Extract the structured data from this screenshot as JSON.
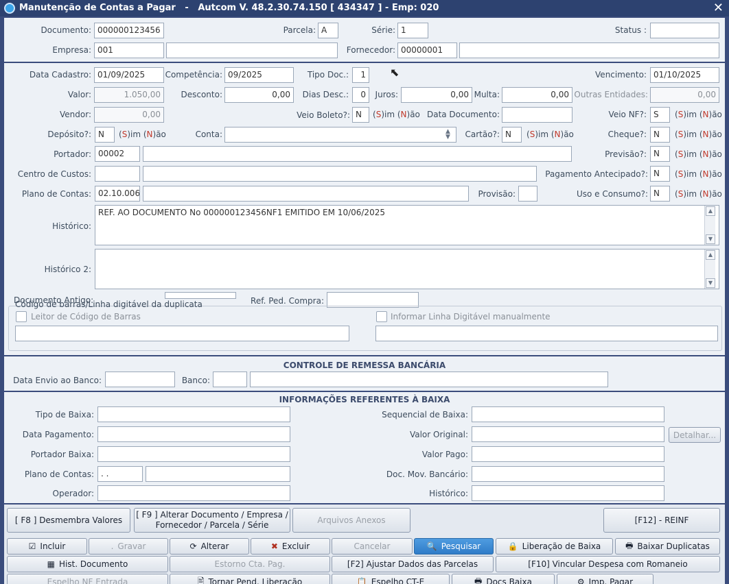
{
  "window": {
    "title": "Manutenção de Contas a Pagar   -   Autcom V. 48.2.30.74.150 [ 434347 ] - Emp: 020",
    "close": "✕"
  },
  "header": {
    "documento_label": "Documento:",
    "documento": "000000123456",
    "parcela_label": "Parcela:",
    "parcela": "A",
    "serie_label": "Série:",
    "serie": "1",
    "status_label": "Status :",
    "status": "",
    "empresa_label": "Empresa:",
    "empresa": "001",
    "empresa_nome": "",
    "fornecedor_label": "Fornecedor:",
    "fornecedor": "00000001",
    "fornecedor_nome": ""
  },
  "form": {
    "data_cadastro_label": "Data Cadastro:",
    "data_cadastro": "01/09/2025",
    "competencia_label": "Competência:",
    "competencia": "09/2025",
    "tipo_doc_label": "Tipo Doc.:",
    "tipo_doc": "1",
    "vencimento_label": "Vencimento:",
    "vencimento": "01/10/2025",
    "valor_label": "Valor:",
    "valor": "1.050,00",
    "desconto_label": "Desconto:",
    "desconto": "0,00",
    "dias_desc_label": "Dias Desc.:",
    "dias_desc": "0",
    "juros_label": "Juros:",
    "juros": "0,00",
    "multa_label": "Multa:",
    "multa": "0,00",
    "outras_label": "Outras Entidades:",
    "outras": "0,00",
    "vendor_label": "Vendor:",
    "vendor": "0,00",
    "veio_boleto_label": "Veio Boleto?:",
    "veio_boleto": "N",
    "data_documento_label": "Data Documento:",
    "data_documento": "",
    "veio_nf_label": "Veio NF?:",
    "veio_nf": "S",
    "deposito_label": "Depósito?:",
    "deposito": "N",
    "conta_label": "Conta:",
    "conta": "",
    "cartao_label": "Cartão?:",
    "cartao": "N",
    "cheque_label": "Cheque?:",
    "cheque": "N",
    "portador_label": "Portador:",
    "portador": "00002",
    "portador_nome": "",
    "previsao_label": "Previsão?:",
    "previsao": "N",
    "centro_label": "Centro de Custos:",
    "centro": "",
    "centro_nome": "",
    "pag_antecipado_label": "Pagamento Antecipado?:",
    "pag_antecipado": "N",
    "plano_label": "Plano de Contas:",
    "plano": "02.10.006",
    "plano_nome": "",
    "provisao_label": "Provisão:",
    "provisao": "",
    "uso_consumo_label": "Uso e Consumo?:",
    "uso_consumo": "N",
    "historico_label": "Histórico:",
    "historico": "REF. AO DOCUMENTO No 000000123456NF1 EMITIDO EM 10/06/2025",
    "historico2_label": "Histórico 2:",
    "historico2": "",
    "doc_antigo_label": "Documento Antigo:",
    "ref_ped_label": "Ref. Ped. Compra:",
    "ref_ped": "",
    "sim": "(S)im",
    "nao": "(N)ão",
    "sim_s": "S",
    "sim_rest": ")im",
    "nao_n": "N",
    "nao_rest": ")ão"
  },
  "barcode": {
    "group_label": "Código de barras/Linha digitável da duplicata",
    "leitor_label": "Leitor de Código de Barras",
    "manual_label": "Informar Linha Digitável manualmente"
  },
  "remessa": {
    "title": "CONTROLE DE REMESSA BANCÁRIA",
    "data_envio_label": "Data Envio ao Banco:",
    "banco_label": "Banco:"
  },
  "baixa": {
    "title": "INFORMAÇÕES REFERENTES À BAIXA",
    "tipo_label": "Tipo de Baixa:",
    "data_pag_label": "Data Pagamento:",
    "portador_label": "Portador Baixa:",
    "plano_label": "Plano de Contas:",
    "plano_val": " .  .",
    "operador_label": "Operador:",
    "sequencial_label": "Sequencial de Baixa:",
    "valor_original_label": "Valor Original:",
    "valor_pago_label": "Valor Pago:",
    "doc_mov_label": "Doc. Mov. Bancário:",
    "historico_label": "Histórico:",
    "detalhar": "Detalhar..."
  },
  "actions": {
    "f8": "[ F8 ] Desmembra Valores",
    "f9_1": "[ F9 ] Alterar Documento / Empresa /",
    "f9_2": "Fornecedor / Parcela / Série",
    "anexos": "Arquivos Anexos",
    "f12": "[F12] - REINF"
  },
  "toolbar": {
    "incluir": "Incluir",
    "gravar": "Gravar",
    "alterar": "Alterar",
    "excluir": "Excluir",
    "cancelar": "Cancelar",
    "pesquisar": "Pesquisar",
    "liberacao": "Liberação de Baixa",
    "baixar": "Baixar Duplicatas",
    "hist": "Hist. Documento",
    "estorno": "Estorno Cta. Pag.",
    "f2": "[F2] Ajustar Dados das Parcelas",
    "f10": "[F10] Vincular Despesa com Romaneio",
    "espelho_nf": "Espelho NF Entrada",
    "tornar": "Tornar Pend. Liberação",
    "espelho_cte": "Espelho CT-E",
    "docs_baixa": "Docs Baixa",
    "imp_pagar": "Imp. Pagar"
  },
  "colors": {
    "titlebar": "#2d4270",
    "panel": "#edf1f6",
    "highlight": "#2f7cc8"
  }
}
